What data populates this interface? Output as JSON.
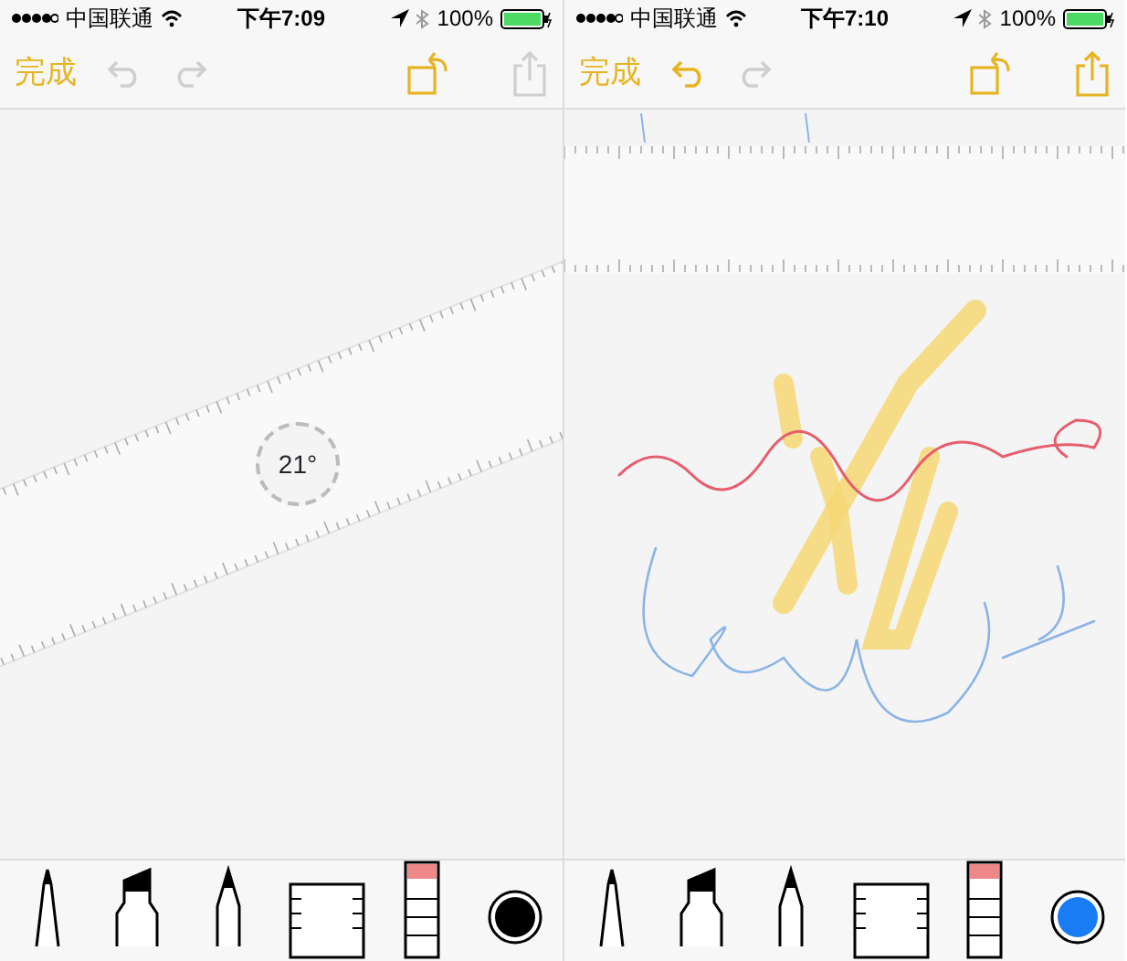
{
  "screens": [
    {
      "status_bar": {
        "carrier": "中国联通",
        "time": "下午7:09",
        "battery": "100%"
      },
      "toolbar": {
        "done": "完成",
        "undo_enabled": false,
        "redo_enabled": false,
        "share_enabled": false
      },
      "canvas": {
        "kind": "ruler",
        "angle": "21°"
      },
      "tools": [
        {
          "kind": "pen"
        },
        {
          "kind": "marker"
        },
        {
          "kind": "pencil"
        },
        {
          "kind": "ruler"
        },
        {
          "kind": "eraser"
        },
        {
          "kind": "color",
          "color": "#000000"
        }
      ]
    },
    {
      "status_bar": {
        "carrier": "中国联通",
        "time": "下午7:10",
        "battery": "100%"
      },
      "toolbar": {
        "done": "完成",
        "undo_enabled": true,
        "redo_enabled": false,
        "share_enabled": true
      },
      "canvas": {
        "kind": "drawing"
      },
      "tools": [
        {
          "kind": "pen"
        },
        {
          "kind": "marker"
        },
        {
          "kind": "pencil"
        },
        {
          "kind": "ruler"
        },
        {
          "kind": "eraser"
        },
        {
          "kind": "color",
          "color": "#1a7cf5"
        }
      ]
    }
  ]
}
